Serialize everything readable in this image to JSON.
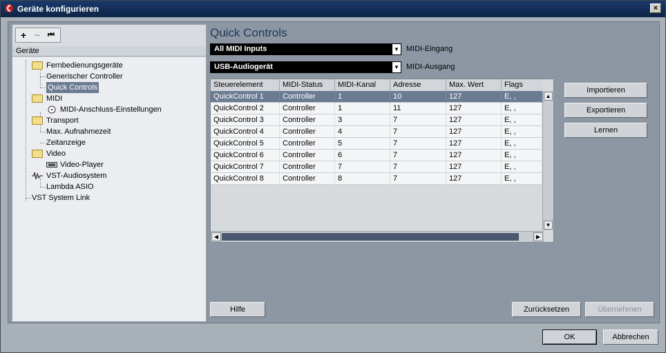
{
  "window": {
    "title": "Geräte konfigurieren",
    "close_glyph": "×"
  },
  "toolbar": {
    "add": "+",
    "remove": "−",
    "reset": "⏮"
  },
  "tree": {
    "header": "Geräte",
    "items": [
      {
        "label": "Fernbedienungsgeräte"
      },
      {
        "label": "Generischer Controller"
      },
      {
        "label": "Quick Controls"
      },
      {
        "label": "MIDI"
      },
      {
        "label": "MIDI-Anschluss-Einstellungen"
      },
      {
        "label": "Transport"
      },
      {
        "label": "Max. Aufnahmezeit"
      },
      {
        "label": "Zeitanzeige"
      },
      {
        "label": "Video"
      },
      {
        "label": "Video-Player"
      },
      {
        "label": "VST-Audiosystem"
      },
      {
        "label": "Lambda ASIO"
      },
      {
        "label": "VST System Link"
      }
    ]
  },
  "main": {
    "title": "Quick Controls",
    "midi_in": {
      "value": "All MIDI Inputs",
      "label": "MIDI-Eingang"
    },
    "midi_out": {
      "value": "USB-Audiogerät",
      "label": "MIDI-Ausgang"
    },
    "table": {
      "columns": [
        "Steuerelement",
        "MIDI-Status",
        "MIDI-Kanal",
        "Adresse",
        "Max. Wert",
        "Flags"
      ],
      "rows": [
        [
          "QuickControl 1",
          "Controller",
          "1",
          "10",
          "127",
          "E, ,"
        ],
        [
          "QuickControl 2",
          "Controller",
          "1",
          "11",
          "127",
          "E, ,"
        ],
        [
          "QuickControl 3",
          "Controller",
          "3",
          "7",
          "127",
          "E, ,"
        ],
        [
          "QuickControl 4",
          "Controller",
          "4",
          "7",
          "127",
          "E, ,"
        ],
        [
          "QuickControl 5",
          "Controller",
          "5",
          "7",
          "127",
          "E, ,"
        ],
        [
          "QuickControl 6",
          "Controller",
          "6",
          "7",
          "127",
          "E, ,"
        ],
        [
          "QuickControl 7",
          "Controller",
          "7",
          "7",
          "127",
          "E, ,"
        ],
        [
          "QuickControl 8",
          "Controller",
          "8",
          "7",
          "127",
          "E, ,"
        ]
      ]
    },
    "buttons": {
      "importieren": "Importieren",
      "exportieren": "Exportieren",
      "lernen": "Lernen",
      "hilfe": "Hilfe",
      "zuruecksetzen": "Zurücksetzen",
      "uebernehmen": "Übernehmen"
    }
  },
  "footer": {
    "ok": "OK",
    "abbrechen": "Abbrechen"
  }
}
